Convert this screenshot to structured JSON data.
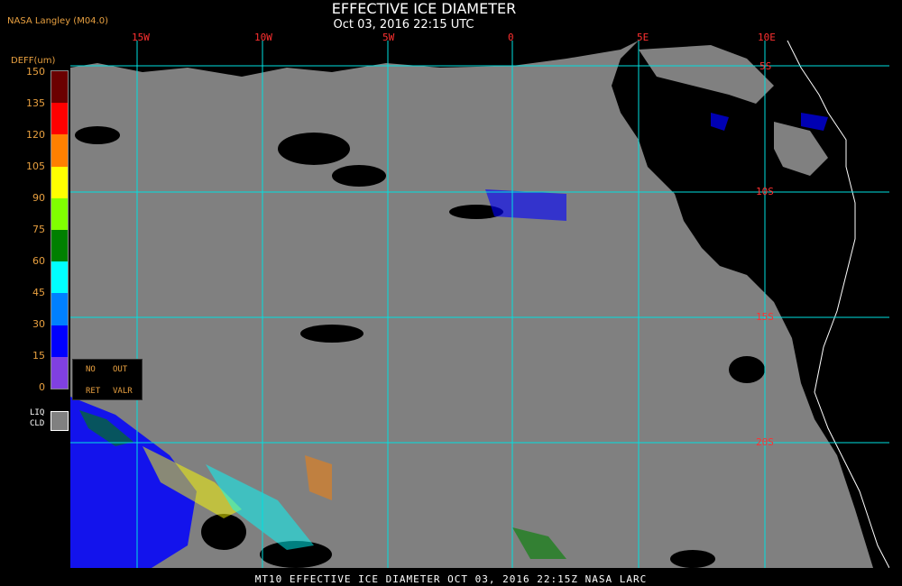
{
  "header": {
    "title": "EFFECTIVE ICE DIAMETER",
    "datetime": "Oct 03, 2016 22:15 UTC",
    "source": "NASA Langley (M04.0)"
  },
  "map": {
    "longitude_labels": [
      "15W",
      "10W",
      "5W",
      "0",
      "5E",
      "10E"
    ],
    "latitude_labels": [
      "5S",
      "10S",
      "15S",
      "20S"
    ],
    "grid_color": "#00e0e0",
    "cloud_color": "#808080",
    "coastline_color": "#ffffff",
    "label_color": "#ff3030"
  },
  "legend": {
    "title": "DEFF(um)",
    "ticks": [
      "150",
      "135",
      "120",
      "105",
      "90",
      "75",
      "60",
      "45",
      "30",
      "15",
      "0"
    ],
    "colors": [
      "#6b0000",
      "#ff0000",
      "#ff8000",
      "#ffff00",
      "#80ff00",
      "#008000",
      "#00ffff",
      "#0080ff",
      "#0000ff",
      "#8040e0"
    ],
    "special_labels": {
      "no": "NO",
      "ret": "RET",
      "out": "OUT",
      "valr": "VALR"
    },
    "liq_label": "LIQ",
    "cld_label": "CLD"
  },
  "footer": {
    "text": "MT10  EFFECTIVE ICE DIAMETER   OCT 03, 2016 22:15Z   NASA LARC"
  }
}
